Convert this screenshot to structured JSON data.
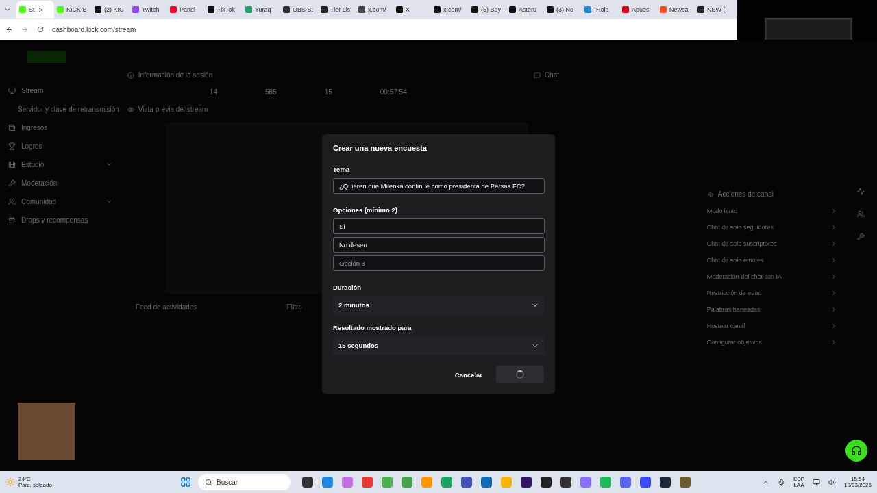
{
  "browser": {
    "tabs": [
      {
        "label": "St",
        "selected": true,
        "color": "#53fc18"
      },
      {
        "label": "KICK B",
        "selected": false,
        "color": "#53fc18"
      },
      {
        "label": "(2) KIC",
        "selected": false,
        "color": "#111111"
      },
      {
        "label": "Twitch",
        "selected": false,
        "color": "#9146ff"
      },
      {
        "label": "Panel",
        "selected": false,
        "color": "#ff0033"
      },
      {
        "label": "TikTok",
        "selected": false,
        "color": "#111111"
      },
      {
        "label": "Yuraq",
        "selected": false,
        "color": "#1fa463"
      },
      {
        "label": "OBS St",
        "selected": false,
        "color": "#302e31"
      },
      {
        "label": "Tier Lis",
        "selected": false,
        "color": "#222222"
      },
      {
        "label": "x.com/",
        "selected": false,
        "color": "#444444"
      },
      {
        "label": "X",
        "selected": false,
        "color": "#111111"
      },
      {
        "label": "x.com/",
        "selected": false,
        "color": "#111111"
      },
      {
        "label": "(6) Bey",
        "selected": false,
        "color": "#111111"
      },
      {
        "label": "Asteru",
        "selected": false,
        "color": "#111111"
      },
      {
        "label": "(3) No",
        "selected": false,
        "color": "#111111"
      },
      {
        "label": "¡Hola",
        "selected": false,
        "color": "#1a8cd8"
      },
      {
        "label": "Apues",
        "selected": false,
        "color": "#d6001c"
      },
      {
        "label": "Newca",
        "selected": false,
        "color": "#ff4f1f"
      },
      {
        "label": "NEW (",
        "selected": false,
        "color": "#222222"
      }
    ],
    "url": "dashboard.kick.com/stream"
  },
  "sidebar": {
    "items": [
      {
        "label": "Stream",
        "expandable": false
      },
      {
        "label": "Servidor y clave de retransmisión",
        "expandable": false
      },
      {
        "label": "Ingresos",
        "expandable": false
      },
      {
        "label": "Logros",
        "expandable": false
      },
      {
        "label": "Estudio",
        "expandable": true
      },
      {
        "label": "Moderación",
        "expandable": false
      },
      {
        "label": "Comunidad",
        "expandable": true
      },
      {
        "label": "Drops y recompensas",
        "expandable": false
      }
    ]
  },
  "session": {
    "title": "Información de la sesión",
    "stats": [
      "14",
      "585",
      "15",
      "00:57:54"
    ],
    "preview_title": "Vista previa del stream"
  },
  "feed": {
    "title": "Feed de actividades",
    "filter": "Filtro"
  },
  "chat": {
    "title": "Chat"
  },
  "actions": {
    "title": "Acciones de canal",
    "items": [
      "Modo lento",
      "Chat de solo seguidores",
      "Chat de solo suscriptores",
      "Chat de solo emotes",
      "Moderación del chat con IA",
      "Restricción de edad",
      "Palabras baneadas",
      "Hostear canal",
      "Configurar objetivos"
    ]
  },
  "dialog": {
    "title": "Crear una nueva encuesta",
    "topic_label": "Tema",
    "topic": "¿Quieren que Milenka continue como presidenta de Persas FC?",
    "options_label": "Opciones (mínimo 2)",
    "options": [
      {
        "value": "Sí"
      },
      {
        "value": "No deseo"
      },
      {
        "placeholder": "Opción 3"
      }
    ],
    "duration_label": "Duración",
    "duration": "2 minutos",
    "result_label": "Resultado mostrado para",
    "result": "15 segundos",
    "cancel": "Cancelar",
    "submit_loading": true
  },
  "taskbar": {
    "temperature": "24°C",
    "weather": "Parc. soleado",
    "search": "Buscar",
    "language": "ESP",
    "layout": "LAA",
    "time": "15:54",
    "date": "10/03/2026"
  }
}
